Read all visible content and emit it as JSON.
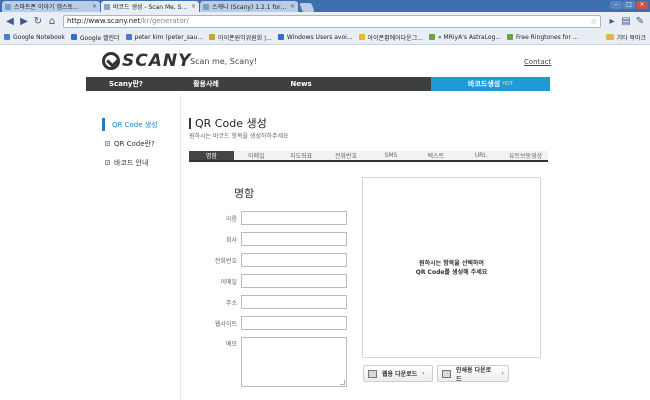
{
  "browser": {
    "tabs": [
      {
        "title": "스마트폰 이야기 앱스토...",
        "active": false
      },
      {
        "title": "바코드 생성 - Scan Me, S...",
        "active": true
      },
      {
        "title": "스캐니 (Scany) 1.2.1 for i...",
        "active": false
      }
    ],
    "address": {
      "host": "http://www.scany.net",
      "path": "/kr/generator/"
    },
    "bookmarks": [
      {
        "label": "Google Notebook",
        "icon": "notebook-icon"
      },
      {
        "label": "Google 캘린더",
        "icon": "calendar-icon"
      },
      {
        "label": "peter kim (peter_sau...",
        "icon": "twitter-icon"
      },
      {
        "label": "아이폰원익위원회 |...",
        "icon": "folder-icon"
      },
      {
        "label": "Windows Users avoi...",
        "icon": "page-icon"
      },
      {
        "label": "아이폰황에어다운그...",
        "icon": "page-icon"
      },
      {
        "label": "« MRiyA's AstraLog...",
        "icon": "page-icon"
      },
      {
        "label": "Free Ringtones for ...",
        "icon": "page-icon"
      }
    ],
    "other_bookmarks": "기타 북마크"
  },
  "site": {
    "brand": "SCANY",
    "tagline": "Scan me, Scany!",
    "contact": "Contact",
    "nav": [
      {
        "label": "Scany란?"
      },
      {
        "label": "활용사례"
      },
      {
        "label": "News"
      },
      {
        "label": ""
      },
      {
        "label": "바코드생성",
        "badge": "HOT"
      }
    ]
  },
  "sidebar": {
    "items": [
      {
        "label": "QR Code 생성"
      },
      {
        "label": "QR Code란?"
      },
      {
        "label": "바코드 안내"
      }
    ]
  },
  "main": {
    "title": "QR Code 생성",
    "subtitle": "원하시는 바코드 항목을 생성하하주세요",
    "tabs": [
      "명함",
      "이메일",
      "지도좌표",
      "전화번호",
      "SMS",
      "텍스트",
      "URL",
      "유트브동영상"
    ],
    "form_title": "명함",
    "fields": [
      {
        "label": "이름",
        "value": ""
      },
      {
        "label": "회사",
        "value": ""
      },
      {
        "label": "전화번호",
        "value": ""
      },
      {
        "label": "이메일",
        "value": ""
      },
      {
        "label": "주소",
        "value": ""
      },
      {
        "label": "웹사이트",
        "value": ""
      },
      {
        "label": "메모",
        "value": ""
      }
    ],
    "preview_line1": "원하시는 항목을 선택하여",
    "preview_line2": "QR Code를 생성해 주세요",
    "download_web": "웹용 다운로드",
    "download_print": "인쇄용 다운로드"
  },
  "colors": {
    "accent": "#1e9bd7",
    "nav_bg": "#3f3f3f",
    "chrome": "#3d6fae"
  }
}
